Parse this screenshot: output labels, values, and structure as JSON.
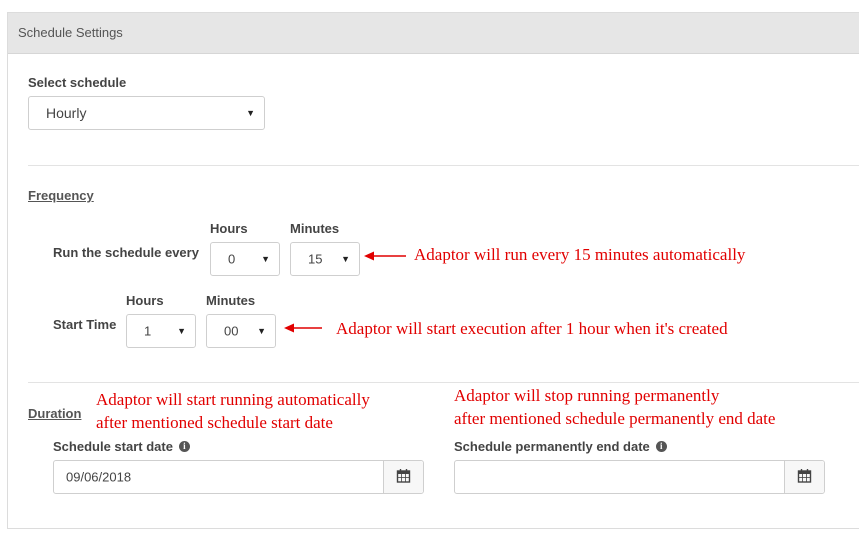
{
  "panel": {
    "title": "Schedule Settings"
  },
  "schedule": {
    "label": "Select schedule",
    "value": "Hourly"
  },
  "frequency": {
    "section": "Frequency",
    "run_every": {
      "label": "Run the schedule every",
      "hours_label": "Hours",
      "hours_value": "0",
      "minutes_label": "Minutes",
      "minutes_value": "15"
    },
    "start_time": {
      "label": "Start Time",
      "hours_label": "Hours",
      "hours_value": "1",
      "minutes_label": "Minutes",
      "minutes_value": "00"
    }
  },
  "duration": {
    "section": "Duration",
    "start_date": {
      "label": "Schedule start date",
      "value": "09/06/2018"
    },
    "end_date": {
      "label": "Schedule permanently end date",
      "value": ""
    }
  },
  "annotations": {
    "run_every": "Adaptor will run every 15 minutes automatically",
    "start_time": "Adaptor will start execution after 1 hour when it's created",
    "start_date_line1": "Adaptor will start running automatically",
    "start_date_line2": "after mentioned schedule start date",
    "end_date_line1": "Adaptor will stop running permanently",
    "end_date_line2": "after mentioned schedule permanently end date"
  },
  "colors": {
    "annotation": "#e10000",
    "header_bg": "#e6e6e6"
  },
  "icons": {
    "caret": "caret-down-icon",
    "info": "info-icon",
    "calendar": "calendar-icon"
  }
}
